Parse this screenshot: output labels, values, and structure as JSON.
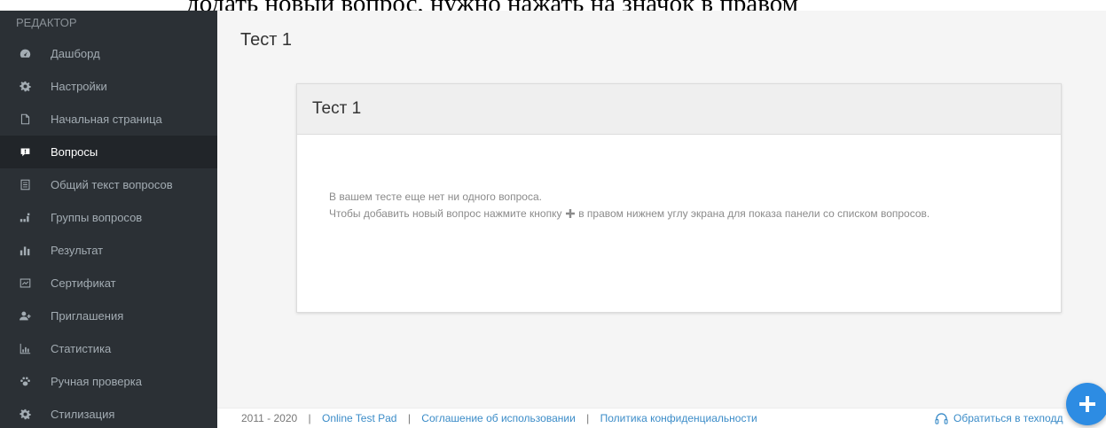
{
  "top_caption": "додать новый вопрос, нужно нажать на значок в правом",
  "sidebar": {
    "header": "РЕДАКТОР",
    "items": [
      {
        "label": "Дашборд",
        "icon": "dashboard-icon"
      },
      {
        "label": "Настройки",
        "icon": "gear-icon"
      },
      {
        "label": "Начальная страница",
        "icon": "file-icon"
      },
      {
        "label": "Вопросы",
        "icon": "question-bubble-icon",
        "active": true
      },
      {
        "label": "Общий текст вопросов",
        "icon": "text-document-icon"
      },
      {
        "label": "Группы вопросов",
        "icon": "groups-icon"
      },
      {
        "label": "Результат",
        "icon": "bar-chart-icon"
      },
      {
        "label": "Сертификат",
        "icon": "certificate-icon"
      },
      {
        "label": "Приглашения",
        "icon": "add-user-icon"
      },
      {
        "label": "Статистика",
        "icon": "statistics-icon"
      },
      {
        "label": "Ручная проверка",
        "icon": "paw-icon"
      },
      {
        "label": "Стилизация",
        "icon": "gear-icon"
      }
    ]
  },
  "main": {
    "title": "Тест 1",
    "panel": {
      "title": "Тест 1",
      "empty_line1": "В вашем тесте еще нет ни одного вопроса.",
      "empty_line2_before": "Чтобы добавить новый вопрос нажмите кнопку",
      "empty_line2_after": "в правом нижнем углу экрана для показа панели со списком вопросов."
    }
  },
  "footer": {
    "years": "2011 - 2020",
    "separator": "|",
    "brand_link": "Online Test Pad",
    "terms_link": "Соглашение об использовании",
    "privacy_link": "Политика конфиденциальности",
    "support_link": "Обратиться в техподд"
  },
  "colors": {
    "accent": "#2d8ce3",
    "sidebar_bg": "#2b3035",
    "link": "#3b8cc8"
  }
}
